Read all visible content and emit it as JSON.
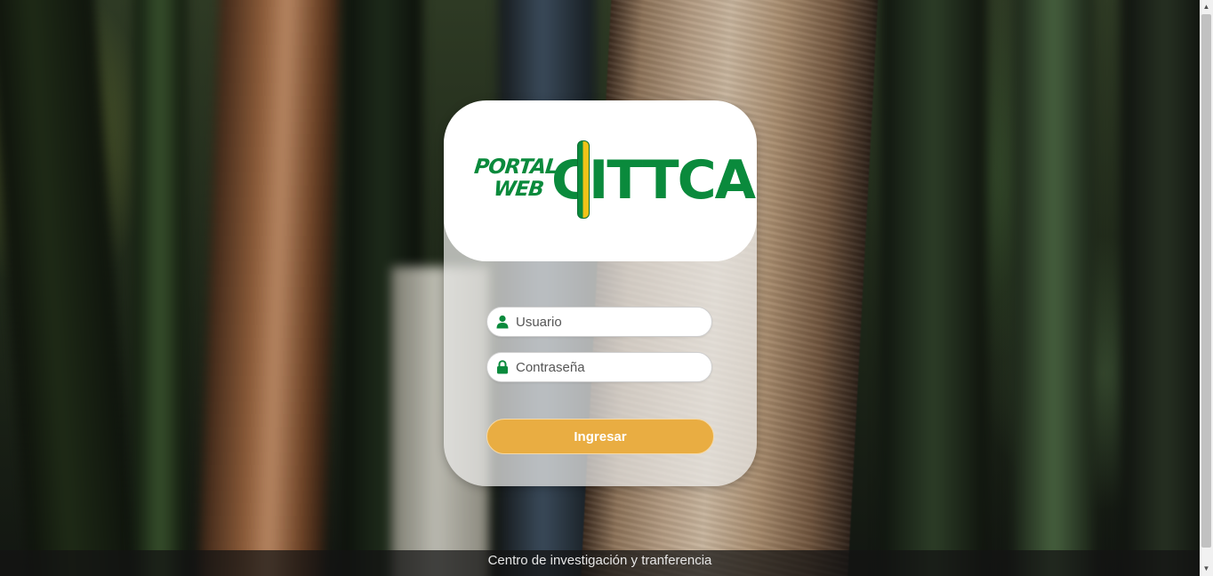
{
  "logo": {
    "portal_line1": "PORTAL",
    "portal_line2": "WEB",
    "brand_text": "CITTCA",
    "brand_color": "#0a8a3c",
    "accent_color": "#f2c318"
  },
  "login": {
    "username_placeholder": "Usuario",
    "username_value": "",
    "username_icon": "user-icon",
    "password_placeholder": "Contraseña",
    "password_value": "",
    "password_icon": "lock-icon",
    "submit_label": "Ingresar",
    "submit_color": "#e9ad42"
  },
  "footer": {
    "text": "Centro de investigación y tranferencia"
  }
}
